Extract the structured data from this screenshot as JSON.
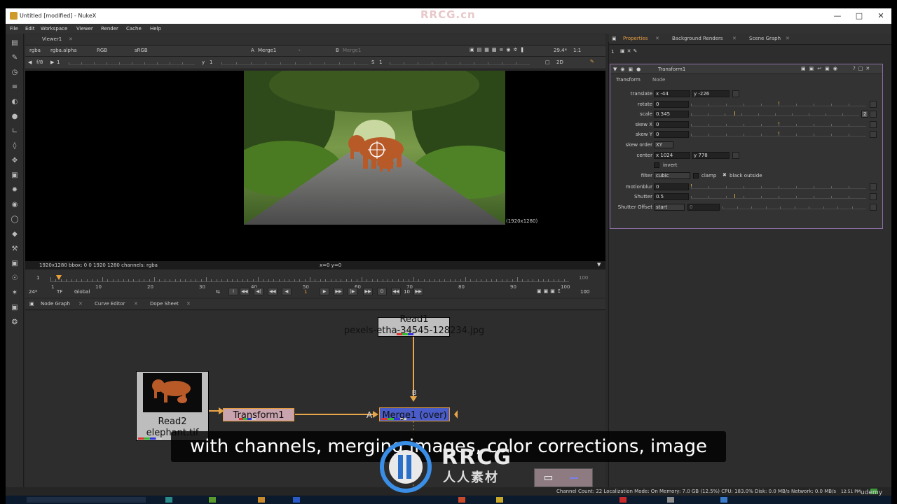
{
  "window": {
    "title": "Untitled [modified] - NukeX",
    "watermark": "RRCG.cn"
  },
  "menu": [
    "File",
    "Edit",
    "Workspace",
    "Viewer",
    "Render",
    "Cache",
    "Help"
  ],
  "viewer": {
    "tab": "Viewer1",
    "channels": "rgba",
    "alpha": "rgba.alpha",
    "color": "RGB",
    "lut": "sRGB",
    "a_input": "Merge1",
    "a_op": "-",
    "b_input": "Merge1",
    "zoom": "29.4*",
    "ratio": "1:1",
    "fstop": "f/8",
    "fvalue": "1",
    "y_label": "y",
    "y_value": "1",
    "s_label": "S",
    "s_value": "1",
    "view_mode": "2D",
    "image_format": "(1920x1280)",
    "status_left": "1920x1280  bbox: 0 0 1920 1280 channels: rgba",
    "status_coords": "x=0 y=0"
  },
  "timeline": {
    "start": "1",
    "end": "100",
    "current_frame": "1",
    "ticks": [
      "1",
      "10",
      "20",
      "30",
      "40",
      "50",
      "60",
      "70",
      "80",
      "90",
      "100"
    ],
    "fps": "24*",
    "tf": "TF",
    "scope": "Global",
    "step": "10",
    "range_end": "100",
    "range_end2": "100"
  },
  "nodegraph": {
    "tabs": [
      "Node Graph",
      "Curve Editor",
      "Dope Sheet"
    ],
    "nodes": {
      "read1_name": "Read1",
      "read1_file": "pexels-etha-34545-128234.jpg",
      "read2_name": "Read2",
      "read2_file": "elephant.tif",
      "transform_name": "Transform1",
      "merge_name": "Merge1 (over)",
      "input_a": "A",
      "input_b": "B"
    }
  },
  "properties": {
    "tabs": [
      "Properties",
      "Background Renders",
      "Scene Graph"
    ],
    "count": "1",
    "node_name": "Transform1",
    "node_tabs": [
      "Transform",
      "Node"
    ],
    "translate_label": "translate",
    "translate_x": "x -44",
    "translate_y": "y -226",
    "rotate_label": "rotate",
    "rotate": "0",
    "scale_label": "scale",
    "scale": "0.345",
    "scale_channels": "2",
    "skewx_label": "skew X",
    "skewx": "0",
    "skewy_label": "skew Y",
    "skewy": "0",
    "skew_order_label": "skew order",
    "skew_order": "XY",
    "center_label": "center",
    "center_x": "x 1024",
    "center_y": "y 778",
    "invert_label": "invert",
    "filter_label": "filter",
    "filter": "cubic",
    "clamp_label": "clamp",
    "black_outside_label": "black outside",
    "motionblur_label": "motionblur",
    "motionblur": "0",
    "shutter_label": "Shutter",
    "shutter": "0.5",
    "shutter_offset_label": "Shutter Offset",
    "shutter_offset": "start",
    "shutter_offset_value": "0"
  },
  "subtitle": "with channels, merging images, color corrections, image",
  "statusbar": "Channel Count: 22  Localization Mode: On  Memory: 7.0 GB (12.5%)  CPU: 183.0%  Disk: 0.0 MB/s  Network: 0.0 MB/s",
  "branding": {
    "logo_text": "RRCG",
    "logo_sub": "人人素材",
    "udemy": "udemy",
    "clock": "12:51 PM"
  }
}
